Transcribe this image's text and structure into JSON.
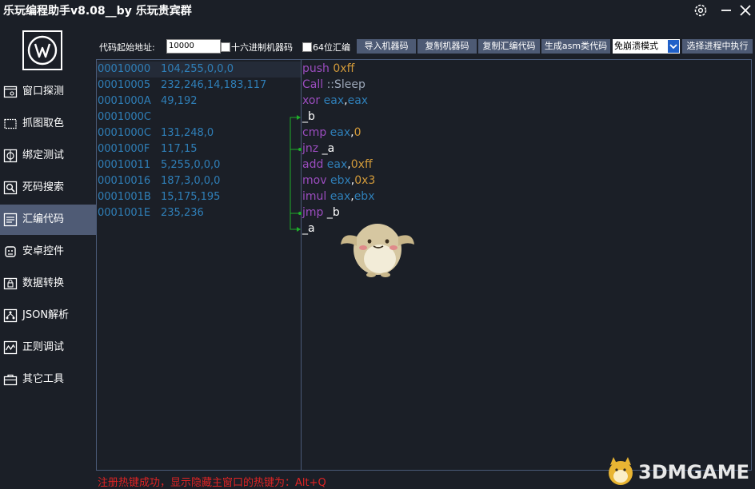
{
  "window": {
    "title": "乐玩编程助手v8.08__by 乐玩贵宾群"
  },
  "sidebar": {
    "items": [
      {
        "label": "窗口探测",
        "icon": "window-probe-icon"
      },
      {
        "label": "抓图取色",
        "icon": "screenshot-color-icon"
      },
      {
        "label": "绑定测试",
        "icon": "bind-test-icon"
      },
      {
        "label": "死码搜索",
        "icon": "search-icon"
      },
      {
        "label": "汇编代码",
        "icon": "assembly-icon",
        "active": true
      },
      {
        "label": "安卓控件",
        "icon": "android-icon"
      },
      {
        "label": "数据转换",
        "icon": "data-convert-icon"
      },
      {
        "label": "JSON解析",
        "icon": "json-icon"
      },
      {
        "label": "正则调试",
        "icon": "regex-icon"
      },
      {
        "label": "其它工具",
        "icon": "toolbox-icon"
      }
    ]
  },
  "toolbar": {
    "address_label": "代码起始地址:",
    "address_value": "10000",
    "hex_label": "十六进制机器码",
    "x64_label": "64位汇编",
    "buttons": [
      "导入机器码",
      "复制机器码",
      "复制汇编代码",
      "生成asm类代码"
    ],
    "mode_selected": "免崩溃模式",
    "execute_button": "选择进程中执行"
  },
  "machine_code": [
    {
      "addr": "00010000",
      "bytes": "104,255,0,0,0"
    },
    {
      "addr": "00010005",
      "bytes": "232,246,14,183,117"
    },
    {
      "addr": "0001000A",
      "bytes": "49,192"
    },
    {
      "addr": "0001000C",
      "bytes": ""
    },
    {
      "addr": "0001000C",
      "bytes": "131,248,0"
    },
    {
      "addr": "0001000F",
      "bytes": "117,15"
    },
    {
      "addr": "00010011",
      "bytes": "5,255,0,0,0"
    },
    {
      "addr": "00010016",
      "bytes": "187,3,0,0,0"
    },
    {
      "addr": "0001001B",
      "bytes": "15,175,195"
    },
    {
      "addr": "0001001E",
      "bytes": "235,236"
    }
  ],
  "assembly": [
    [
      {
        "t": "push",
        "c": "kw"
      },
      {
        "t": " ",
        "c": "wt"
      },
      {
        "t": "0xff",
        "c": "num"
      }
    ],
    [
      {
        "t": "Call",
        "c": "kw"
      },
      {
        "t": " ::Sleep",
        "c": "fn"
      }
    ],
    [
      {
        "t": "xor",
        "c": "kw"
      },
      {
        "t": " eax",
        "c": "reg"
      },
      {
        "t": ",",
        "c": "wt"
      },
      {
        "t": "eax",
        "c": "reg"
      }
    ],
    [
      {
        "t": "_b",
        "c": "wt"
      }
    ],
    [
      {
        "t": "cmp",
        "c": "kw"
      },
      {
        "t": " eax",
        "c": "reg"
      },
      {
        "t": ",",
        "c": "wt"
      },
      {
        "t": "0",
        "c": "num"
      }
    ],
    [
      {
        "t": "jnz",
        "c": "kw"
      },
      {
        "t": " _a",
        "c": "wt"
      }
    ],
    [
      {
        "t": "add",
        "c": "kw"
      },
      {
        "t": " eax",
        "c": "reg"
      },
      {
        "t": ",",
        "c": "wt"
      },
      {
        "t": "0xff",
        "c": "num"
      }
    ],
    [
      {
        "t": "mov",
        "c": "kw"
      },
      {
        "t": " ebx",
        "c": "reg"
      },
      {
        "t": ",",
        "c": "wt"
      },
      {
        "t": "0x3",
        "c": "num"
      }
    ],
    [
      {
        "t": "imul",
        "c": "kw"
      },
      {
        "t": " eax",
        "c": "reg"
      },
      {
        "t": ",",
        "c": "wt"
      },
      {
        "t": "ebx",
        "c": "reg"
      }
    ],
    [
      {
        "t": "jmp",
        "c": "kw"
      },
      {
        "t": " _b",
        "c": "wt"
      }
    ],
    [
      {
        "t": "_a",
        "c": "wt"
      }
    ]
  ],
  "status": "注册热键成功，显示隐藏主窗口的热键为：Alt+Q",
  "watermark": "3DMGAME",
  "colors": {
    "background": "#1b1f27",
    "accent": "#4f5b75",
    "address_text": "#2f7fb8",
    "keyword": "#9b4dbf",
    "number": "#d29a3a",
    "status_text": "#e02424",
    "jump_arrow": "#1fae2a"
  }
}
